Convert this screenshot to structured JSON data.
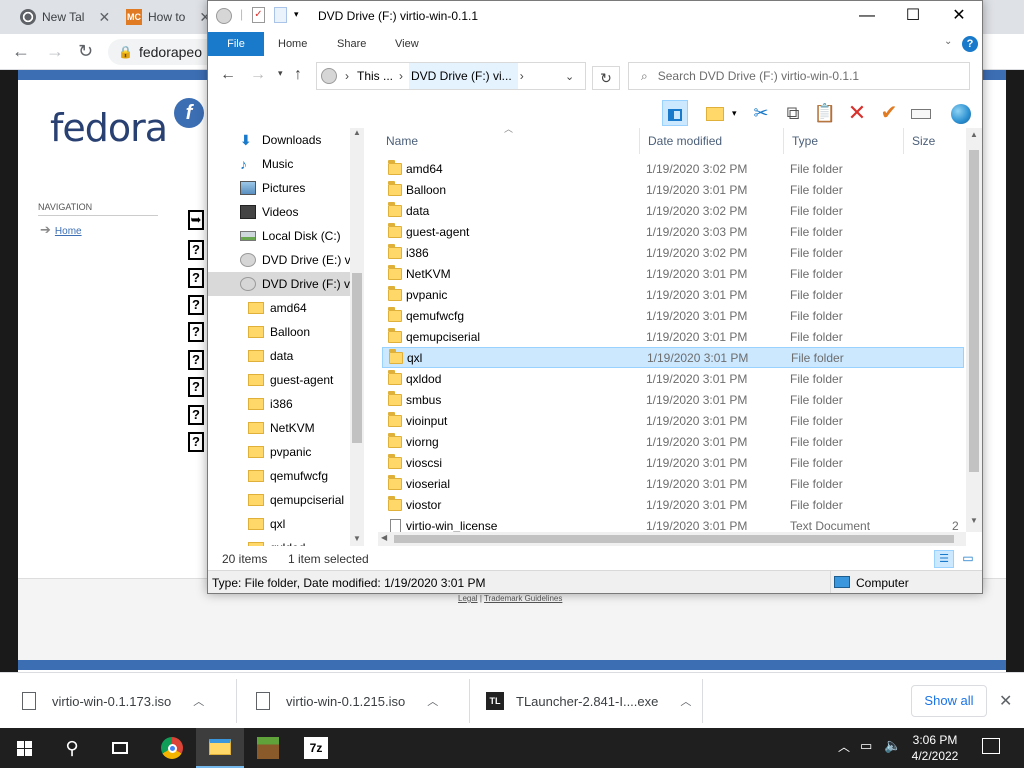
{
  "browser": {
    "tabs": [
      {
        "label": "New Tal",
        "icon": "chrome-icon"
      },
      {
        "label": "How to",
        "icon": "mc-icon",
        "badge": "MC"
      }
    ],
    "url": "fedorapeo"
  },
  "webpage": {
    "logo": "fedora",
    "logo_mark": "f",
    "nav_title": "NAVIGATION",
    "nav_home": "Home",
    "footer_legal": "Legal",
    "footer_sep": "|",
    "footer_trademark": "Trademark Guidelines"
  },
  "explorer": {
    "title": "DVD Drive (F:) virtio-win-0.1.1",
    "ribbon_tabs": [
      "File",
      "Home",
      "Share",
      "View"
    ],
    "breadcrumb": [
      "This ...",
      "DVD Drive (F:) vi..."
    ],
    "search_placeholder": "Search DVD Drive (F:) virtio-win-0.1.1",
    "nav_items": [
      {
        "label": "Downloads",
        "icon": "download-icon",
        "indent": 0
      },
      {
        "label": "Music",
        "icon": "music-icon",
        "indent": 0
      },
      {
        "label": "Pictures",
        "icon": "pictures-icon",
        "indent": 0
      },
      {
        "label": "Videos",
        "icon": "videos-icon",
        "indent": 0
      },
      {
        "label": "Local Disk (C:)",
        "icon": "local-disk-icon",
        "indent": 0
      },
      {
        "label": "DVD Drive (E:) vi",
        "icon": "dvd-drive-icon",
        "indent": 0
      },
      {
        "label": "DVD Drive (F:) vi",
        "icon": "dvd-drive-icon",
        "indent": 0,
        "selected": true
      },
      {
        "label": "amd64",
        "icon": "folder-icon",
        "indent": 1
      },
      {
        "label": "Balloon",
        "icon": "folder-icon",
        "indent": 1
      },
      {
        "label": "data",
        "icon": "folder-icon",
        "indent": 1
      },
      {
        "label": "guest-agent",
        "icon": "folder-icon",
        "indent": 1
      },
      {
        "label": "i386",
        "icon": "folder-icon",
        "indent": 1
      },
      {
        "label": "NetKVM",
        "icon": "folder-icon",
        "indent": 1
      },
      {
        "label": "pvpanic",
        "icon": "folder-icon",
        "indent": 1
      },
      {
        "label": "qemufwcfg",
        "icon": "folder-icon",
        "indent": 1
      },
      {
        "label": "qemupciserial",
        "icon": "folder-icon",
        "indent": 1
      },
      {
        "label": "qxl",
        "icon": "folder-icon",
        "indent": 1
      },
      {
        "label": "qxldod",
        "icon": "folder-icon",
        "indent": 1
      }
    ],
    "columns": {
      "name": "Name",
      "date": "Date modified",
      "type": "Type",
      "size": "Size"
    },
    "files": [
      {
        "name": "amd64",
        "date": "1/19/2020 3:02 PM",
        "type": "File folder",
        "kind": "folder"
      },
      {
        "name": "Balloon",
        "date": "1/19/2020 3:01 PM",
        "type": "File folder",
        "kind": "folder"
      },
      {
        "name": "data",
        "date": "1/19/2020 3:02 PM",
        "type": "File folder",
        "kind": "folder"
      },
      {
        "name": "guest-agent",
        "date": "1/19/2020 3:03 PM",
        "type": "File folder",
        "kind": "folder"
      },
      {
        "name": "i386",
        "date": "1/19/2020 3:02 PM",
        "type": "File folder",
        "kind": "folder"
      },
      {
        "name": "NetKVM",
        "date": "1/19/2020 3:01 PM",
        "type": "File folder",
        "kind": "folder"
      },
      {
        "name": "pvpanic",
        "date": "1/19/2020 3:01 PM",
        "type": "File folder",
        "kind": "folder"
      },
      {
        "name": "qemufwcfg",
        "date": "1/19/2020 3:01 PM",
        "type": "File folder",
        "kind": "folder"
      },
      {
        "name": "qemupciserial",
        "date": "1/19/2020 3:01 PM",
        "type": "File folder",
        "kind": "folder"
      },
      {
        "name": "qxl",
        "date": "1/19/2020 3:01 PM",
        "type": "File folder",
        "kind": "folder",
        "selected": true
      },
      {
        "name": "qxldod",
        "date": "1/19/2020 3:01 PM",
        "type": "File folder",
        "kind": "folder"
      },
      {
        "name": "smbus",
        "date": "1/19/2020 3:01 PM",
        "type": "File folder",
        "kind": "folder"
      },
      {
        "name": "vioinput",
        "date": "1/19/2020 3:01 PM",
        "type": "File folder",
        "kind": "folder"
      },
      {
        "name": "viorng",
        "date": "1/19/2020 3:01 PM",
        "type": "File folder",
        "kind": "folder"
      },
      {
        "name": "vioscsi",
        "date": "1/19/2020 3:01 PM",
        "type": "File folder",
        "kind": "folder"
      },
      {
        "name": "vioserial",
        "date": "1/19/2020 3:01 PM",
        "type": "File folder",
        "kind": "folder"
      },
      {
        "name": "viostor",
        "date": "1/19/2020 3:01 PM",
        "type": "File folder",
        "kind": "folder"
      },
      {
        "name": "virtio-win_license",
        "date": "1/19/2020 3:01 PM",
        "type": "Text Document",
        "size": "2",
        "kind": "document"
      }
    ],
    "status_count": "20 items",
    "status_selected": "1 item selected",
    "details": "Type: File folder, Date modified: 1/19/2020 3:01 PM",
    "details_location": "Computer"
  },
  "downloads": [
    {
      "name": "virtio-win-0.1.173.iso",
      "icon": "file-icon"
    },
    {
      "name": "virtio-win-0.1.215.iso",
      "icon": "file-icon"
    },
    {
      "name": "TLauncher-2.841-I....exe",
      "icon": "tlauncher-icon",
      "badge": "TL"
    }
  ],
  "show_all": "Show all",
  "taskbar": {
    "time": "3:06 PM",
    "date": "4/2/2022",
    "pinned": [
      {
        "name": "start",
        "icon": "windows-icon"
      },
      {
        "name": "search",
        "icon": "search-icon"
      },
      {
        "name": "task-view",
        "icon": "task-view-icon"
      },
      {
        "name": "chrome",
        "icon": "chrome-icon"
      },
      {
        "name": "file-explorer",
        "icon": "file-explorer-icon",
        "active": true
      },
      {
        "name": "minecraft",
        "icon": "minecraft-icon"
      },
      {
        "name": "7zip",
        "icon": "7zip-icon",
        "label": "7z"
      }
    ]
  },
  "colors": {
    "accent": "#1979ca",
    "selection": "#cce8ff",
    "fedora_blue": "#3c6eb4",
    "folder": "#ffd869",
    "taskbar": "#1f1f1f"
  }
}
